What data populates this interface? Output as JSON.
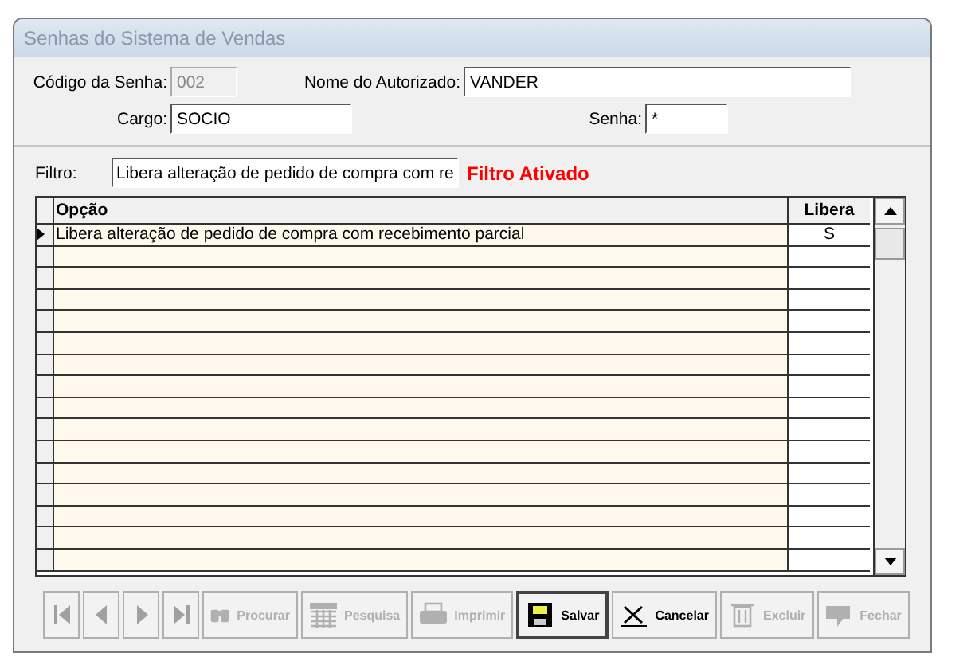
{
  "window": {
    "title": "Senhas do Sistema de Vendas"
  },
  "fields": [
    {
      "label": "Código da Senha:",
      "value": "002",
      "disabled": true
    },
    {
      "label": "Nome do Autorizado:",
      "value": "VANDER",
      "disabled": false
    },
    {
      "label": "Cargo:",
      "value": "SOCIO",
      "disabled": false
    },
    {
      "label": "Senha:",
      "value": "*",
      "disabled": false
    }
  ],
  "filter": {
    "label": "Filtro:",
    "value": "Libera alteração de pedido de compra com re",
    "status": "Filtro Ativado"
  },
  "table": {
    "columns": [
      "Opção",
      "Libera"
    ],
    "rows": [
      {
        "cells": [
          "Libera alteração de pedido de compra com recebimento parcial",
          "S"
        ],
        "selected": true
      }
    ]
  },
  "toolbar": [
    {
      "kind": "first",
      "disabled": true
    },
    {
      "kind": "prev",
      "disabled": true
    },
    {
      "kind": "next",
      "disabled": true
    },
    {
      "kind": "last",
      "disabled": true
    },
    {
      "kind": "search",
      "label": "Procurar",
      "disabled": true
    },
    {
      "kind": "grid",
      "label": "Pesquisa",
      "disabled": true
    },
    {
      "kind": "print",
      "label": "Imprimir",
      "disabled": true
    },
    {
      "kind": "save",
      "label": "Salvar",
      "disabled": false
    },
    {
      "kind": "cancel",
      "label": "Cancelar",
      "disabled": false
    },
    {
      "kind": "delete",
      "label": "Excluir",
      "disabled": true
    },
    {
      "kind": "close",
      "label": "Fechar",
      "disabled": true
    }
  ]
}
